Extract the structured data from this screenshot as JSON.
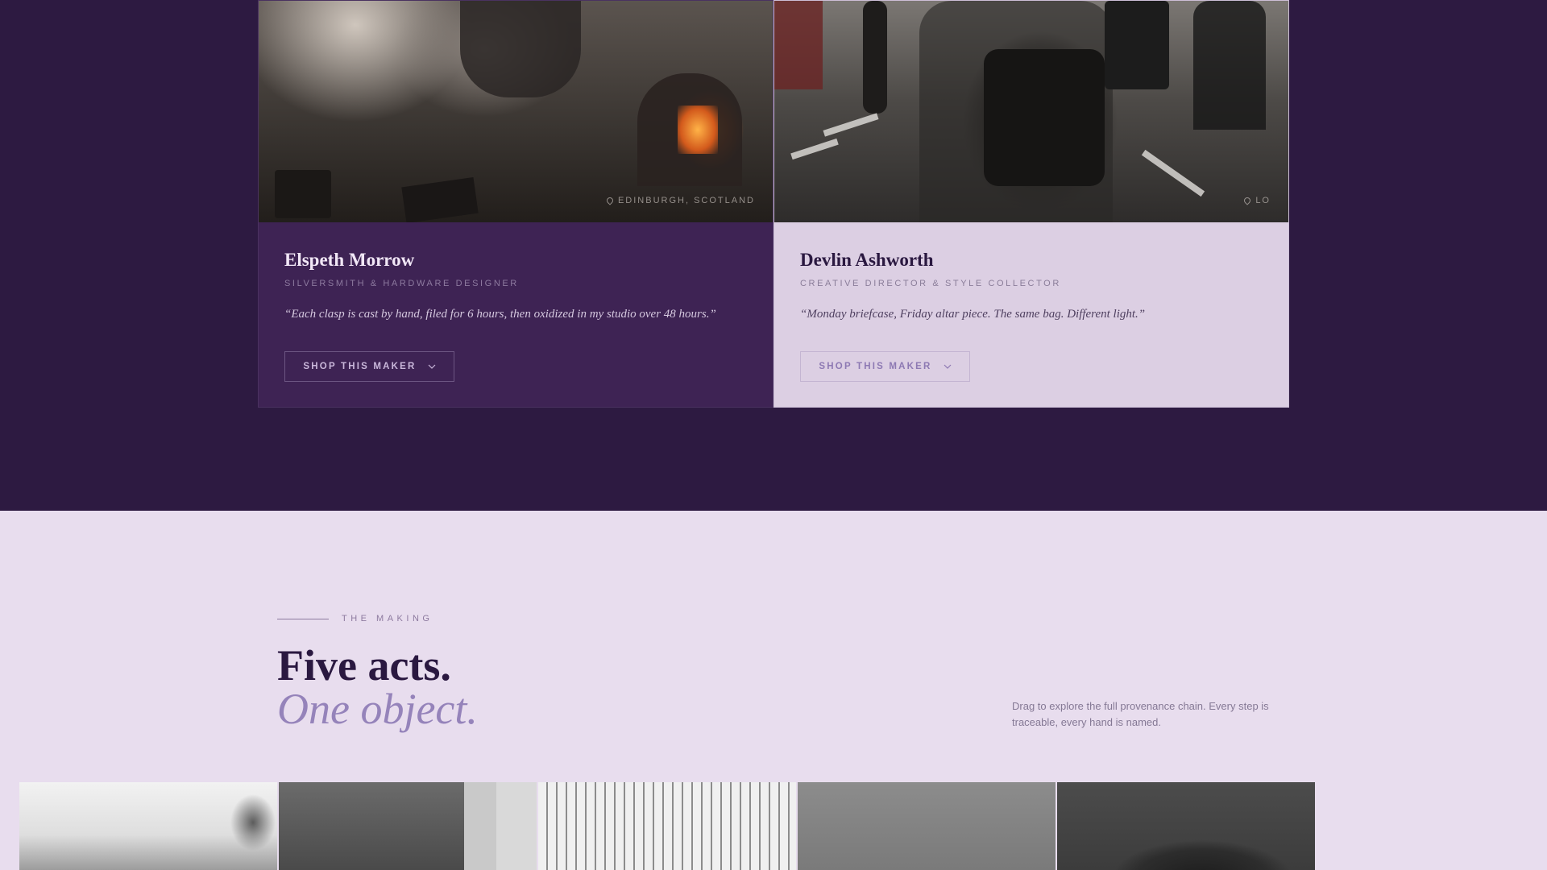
{
  "makers": [
    {
      "name": "Elspeth Morrow",
      "role": "SILVERSMITH & HARDWARE DESIGNER",
      "quote": "“Each clasp is cast by hand, filed for 6 hours, then oxidized in my studio over 48 hours.”",
      "location": "EDINBURGH, SCOTLAND",
      "button_label": "SHOP THIS MAKER"
    },
    {
      "name": "Devlin Ashworth",
      "role": "CREATIVE DIRECTOR & STYLE COLLECTOR",
      "quote": "“Monday briefcase, Friday altar piece. The same bag. Different light.”",
      "location": "LO",
      "button_label": "SHOP THIS MAKER"
    }
  ],
  "making": {
    "eyebrow": "THE MAKING",
    "title": "Five acts.",
    "subtitle": "One object.",
    "note": "Drag to explore the full provenance chain. Every step is traceable, every hand is named."
  },
  "colors": {
    "top_background": "#2d1a41",
    "card_dark": "#3e2354",
    "card_light": "#dccfe3",
    "page_background": "#e8ddee",
    "accent": "#9583ba"
  },
  "icons": {
    "location": "pin-icon",
    "button": "chevron-down-icon"
  }
}
